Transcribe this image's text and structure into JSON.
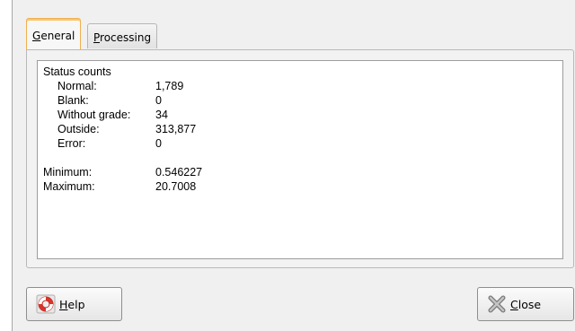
{
  "tabs": [
    {
      "label_u": "G",
      "label_rest": "eneral",
      "active": true
    },
    {
      "label_u": "P",
      "label_rest": "rocessing",
      "active": false
    }
  ],
  "general": {
    "heading": "Status counts",
    "counts": [
      {
        "label": "Normal:",
        "value": "1,789"
      },
      {
        "label": "Blank:",
        "value": "0"
      },
      {
        "label": "Without grade:",
        "value": "34"
      },
      {
        "label": "Outside:",
        "value": "313,877"
      },
      {
        "label": "Error:",
        "value": "0"
      }
    ],
    "minimum_label": "Minimum:",
    "minimum_value": "0.546227",
    "maximum_label": "Maximum:",
    "maximum_value": "20.7008"
  },
  "buttons": {
    "help": {
      "label_u": "H",
      "label_rest": "elp",
      "icon": "lifebuoy-icon"
    },
    "close": {
      "label_u": "C",
      "label_rest": "lose",
      "icon": "close-x-icon"
    }
  },
  "colors": {
    "active_tab_accent": "#f0b050",
    "help_icon": "#d9342b"
  }
}
